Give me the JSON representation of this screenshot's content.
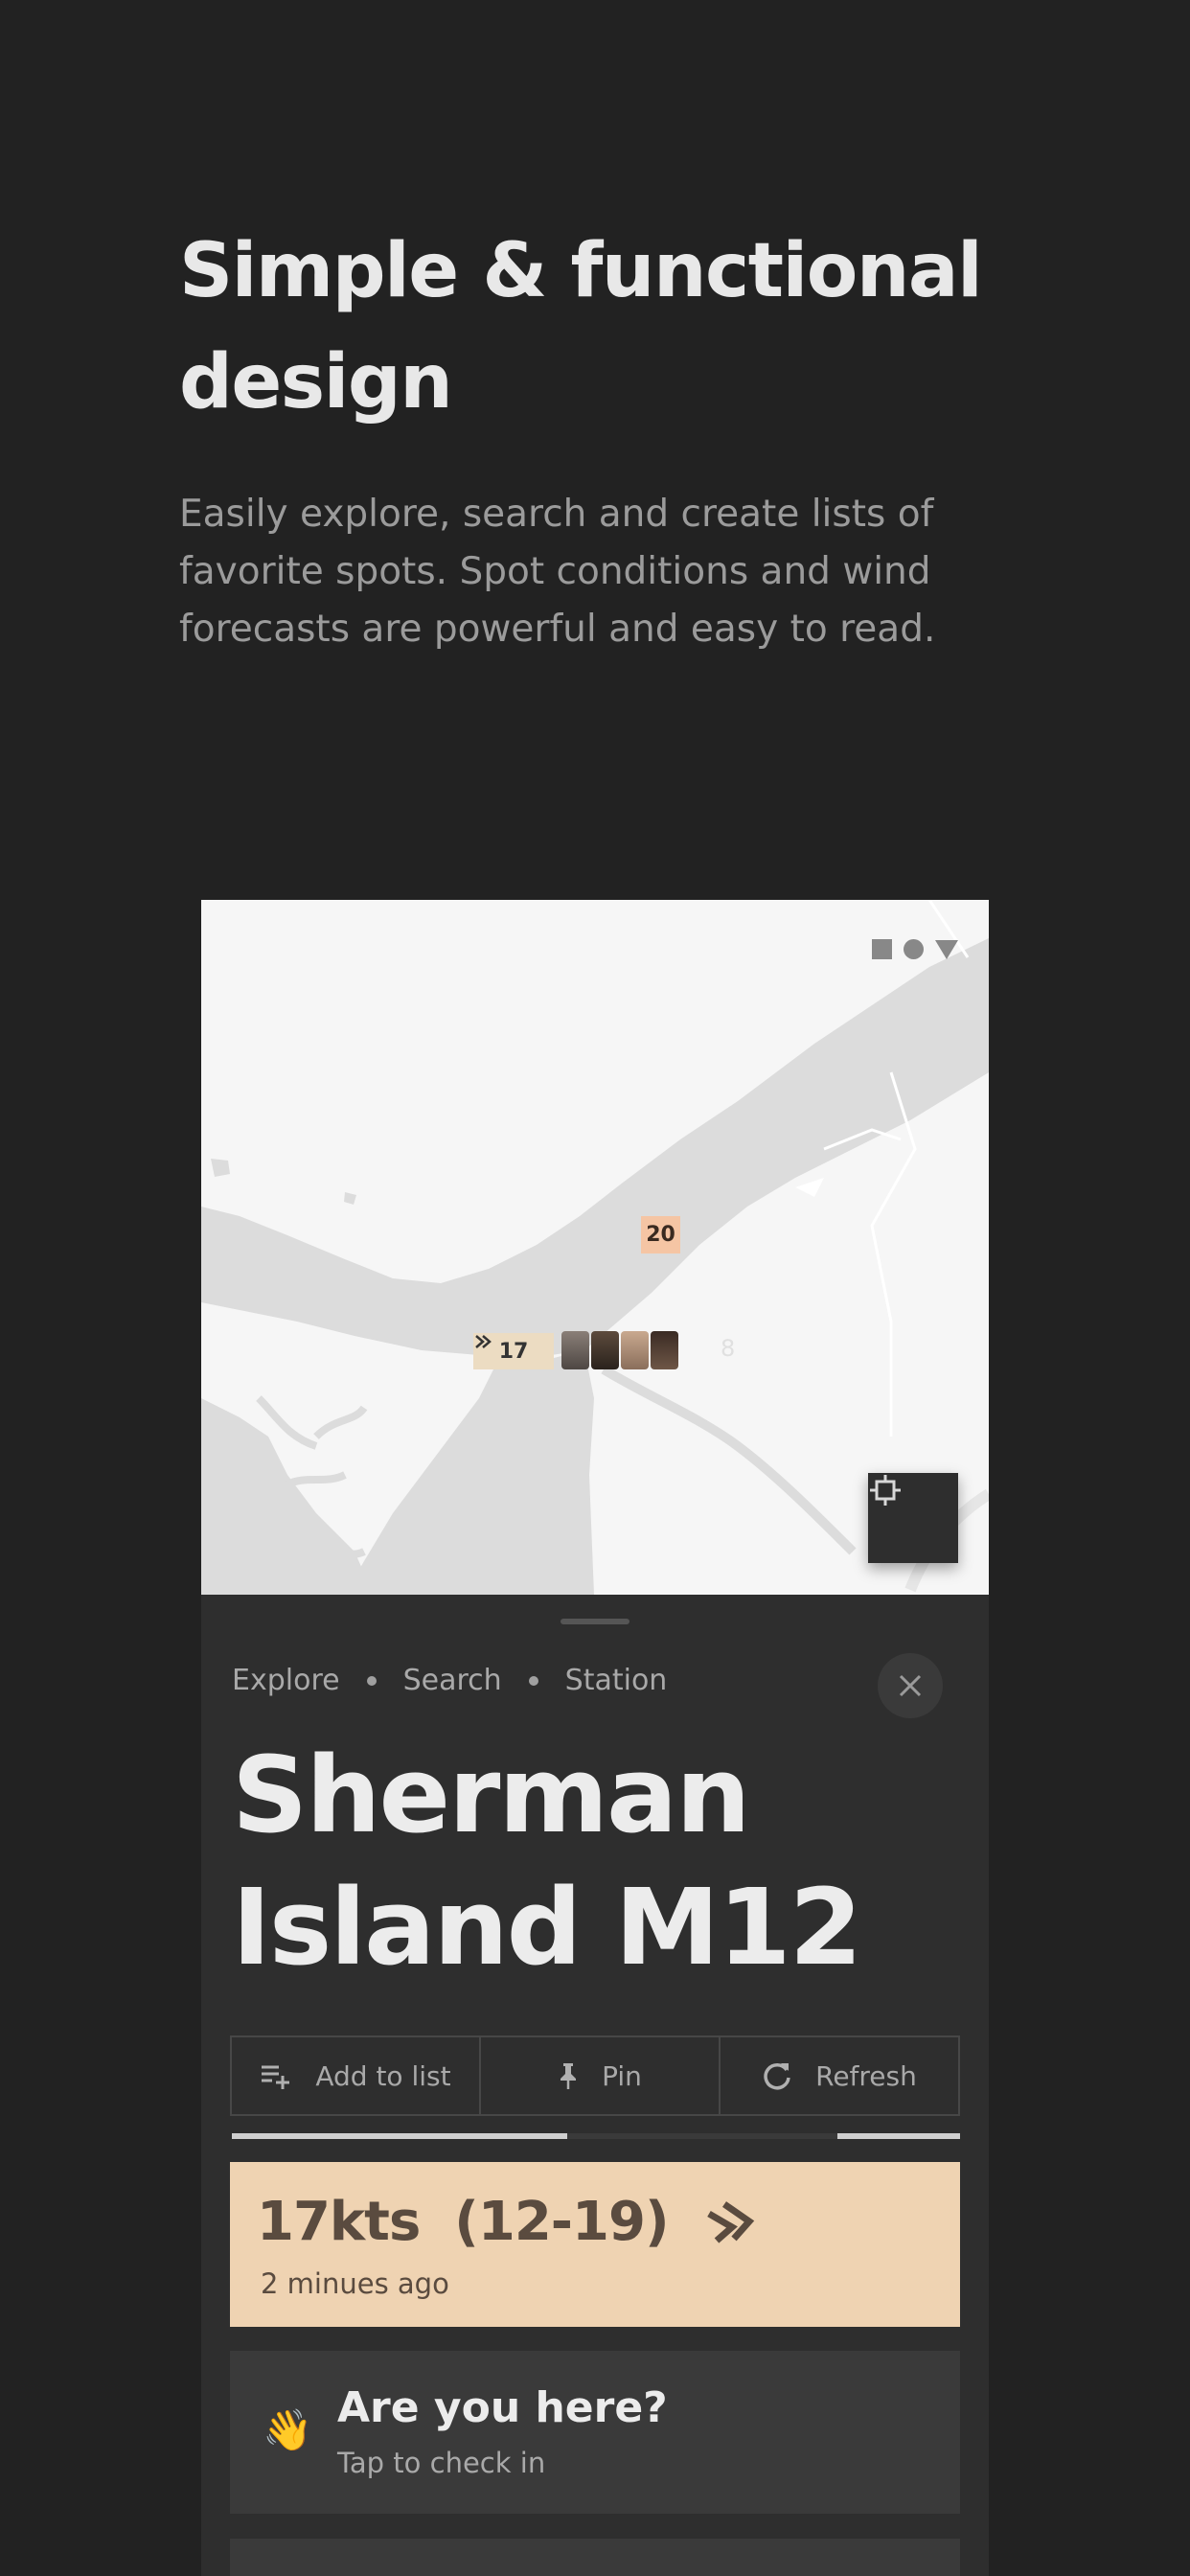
{
  "hero": {
    "title": "Simple & functional design",
    "subtitle": "Easily explore, search and create lists of favorite spots. Spot conditions and wind forecasts are powerful and easy to read."
  },
  "map": {
    "tools": [
      "square-icon",
      "circle-icon",
      "triangle-icon"
    ],
    "markers": {
      "north": "20",
      "main": "17"
    },
    "avatar_count": "8"
  },
  "sheet": {
    "breadcrumbs": [
      "Explore",
      "Search",
      "Station"
    ],
    "title": "Sherman Island M12",
    "actions": {
      "add_to_list": "Add to list",
      "pin": "Pin",
      "refresh": "Refresh"
    },
    "progress": 0.46,
    "wind": {
      "speed": "17kts",
      "range": "(12-19)",
      "updated": "2 minues ago"
    },
    "checkin": {
      "emoji": "👋",
      "title": "Are you here?",
      "subtitle": "Tap to check in"
    }
  },
  "colors": {
    "background": "#222222",
    "sheet": "#2e2e2e",
    "wind_card": "#efd3b2",
    "marker_high": "#f5c5a4",
    "marker_main": "#ecdcc2"
  }
}
